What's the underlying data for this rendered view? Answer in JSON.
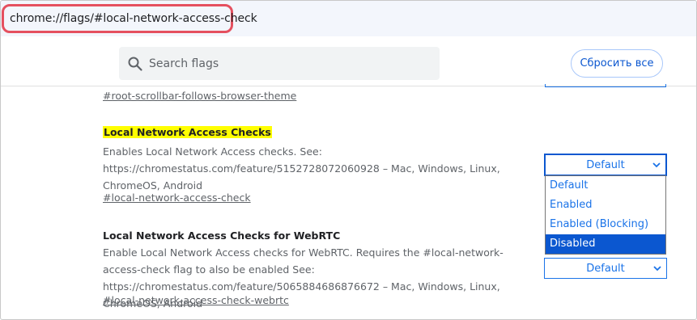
{
  "address": {
    "scheme": "chrome://",
    "host": "flags",
    "path": "/#local-network-access-check"
  },
  "header": {
    "search_placeholder": "Search flags",
    "reset_label": "Сбросить все"
  },
  "flags": [
    {
      "anchor": "#root-scrollbar-follows-browser-theme"
    },
    {
      "title": "Local Network Access Checks",
      "description": "Enables Local Network Access checks. See: https://chromestatus.com/feature/5152728072060928 – Mac, Windows, Linux, ChromeOS, Android",
      "anchor": "#local-network-access-check",
      "select_value": "Default",
      "options": [
        "Default",
        "Enabled",
        "Enabled (Blocking)",
        "Disabled"
      ],
      "highlighted_option": "Disabled"
    },
    {
      "title": "Local Network Access Checks for WebRTC",
      "description": "Enable Local Network Access checks for WebRTC. Requires the #local-network-access-check flag to also be enabled See: https://chromestatus.com/feature/5065884686876672 – Mac, Windows, Linux, ChromeOS, Android",
      "anchor": "#local-network-access-check-webrtc",
      "select_value": "Default"
    }
  ],
  "colors": {
    "accent": "#1a73e8",
    "highlight": "#ffff00",
    "url_outline": "#e5505f",
    "selected_option_bg": "#0b57d0"
  }
}
